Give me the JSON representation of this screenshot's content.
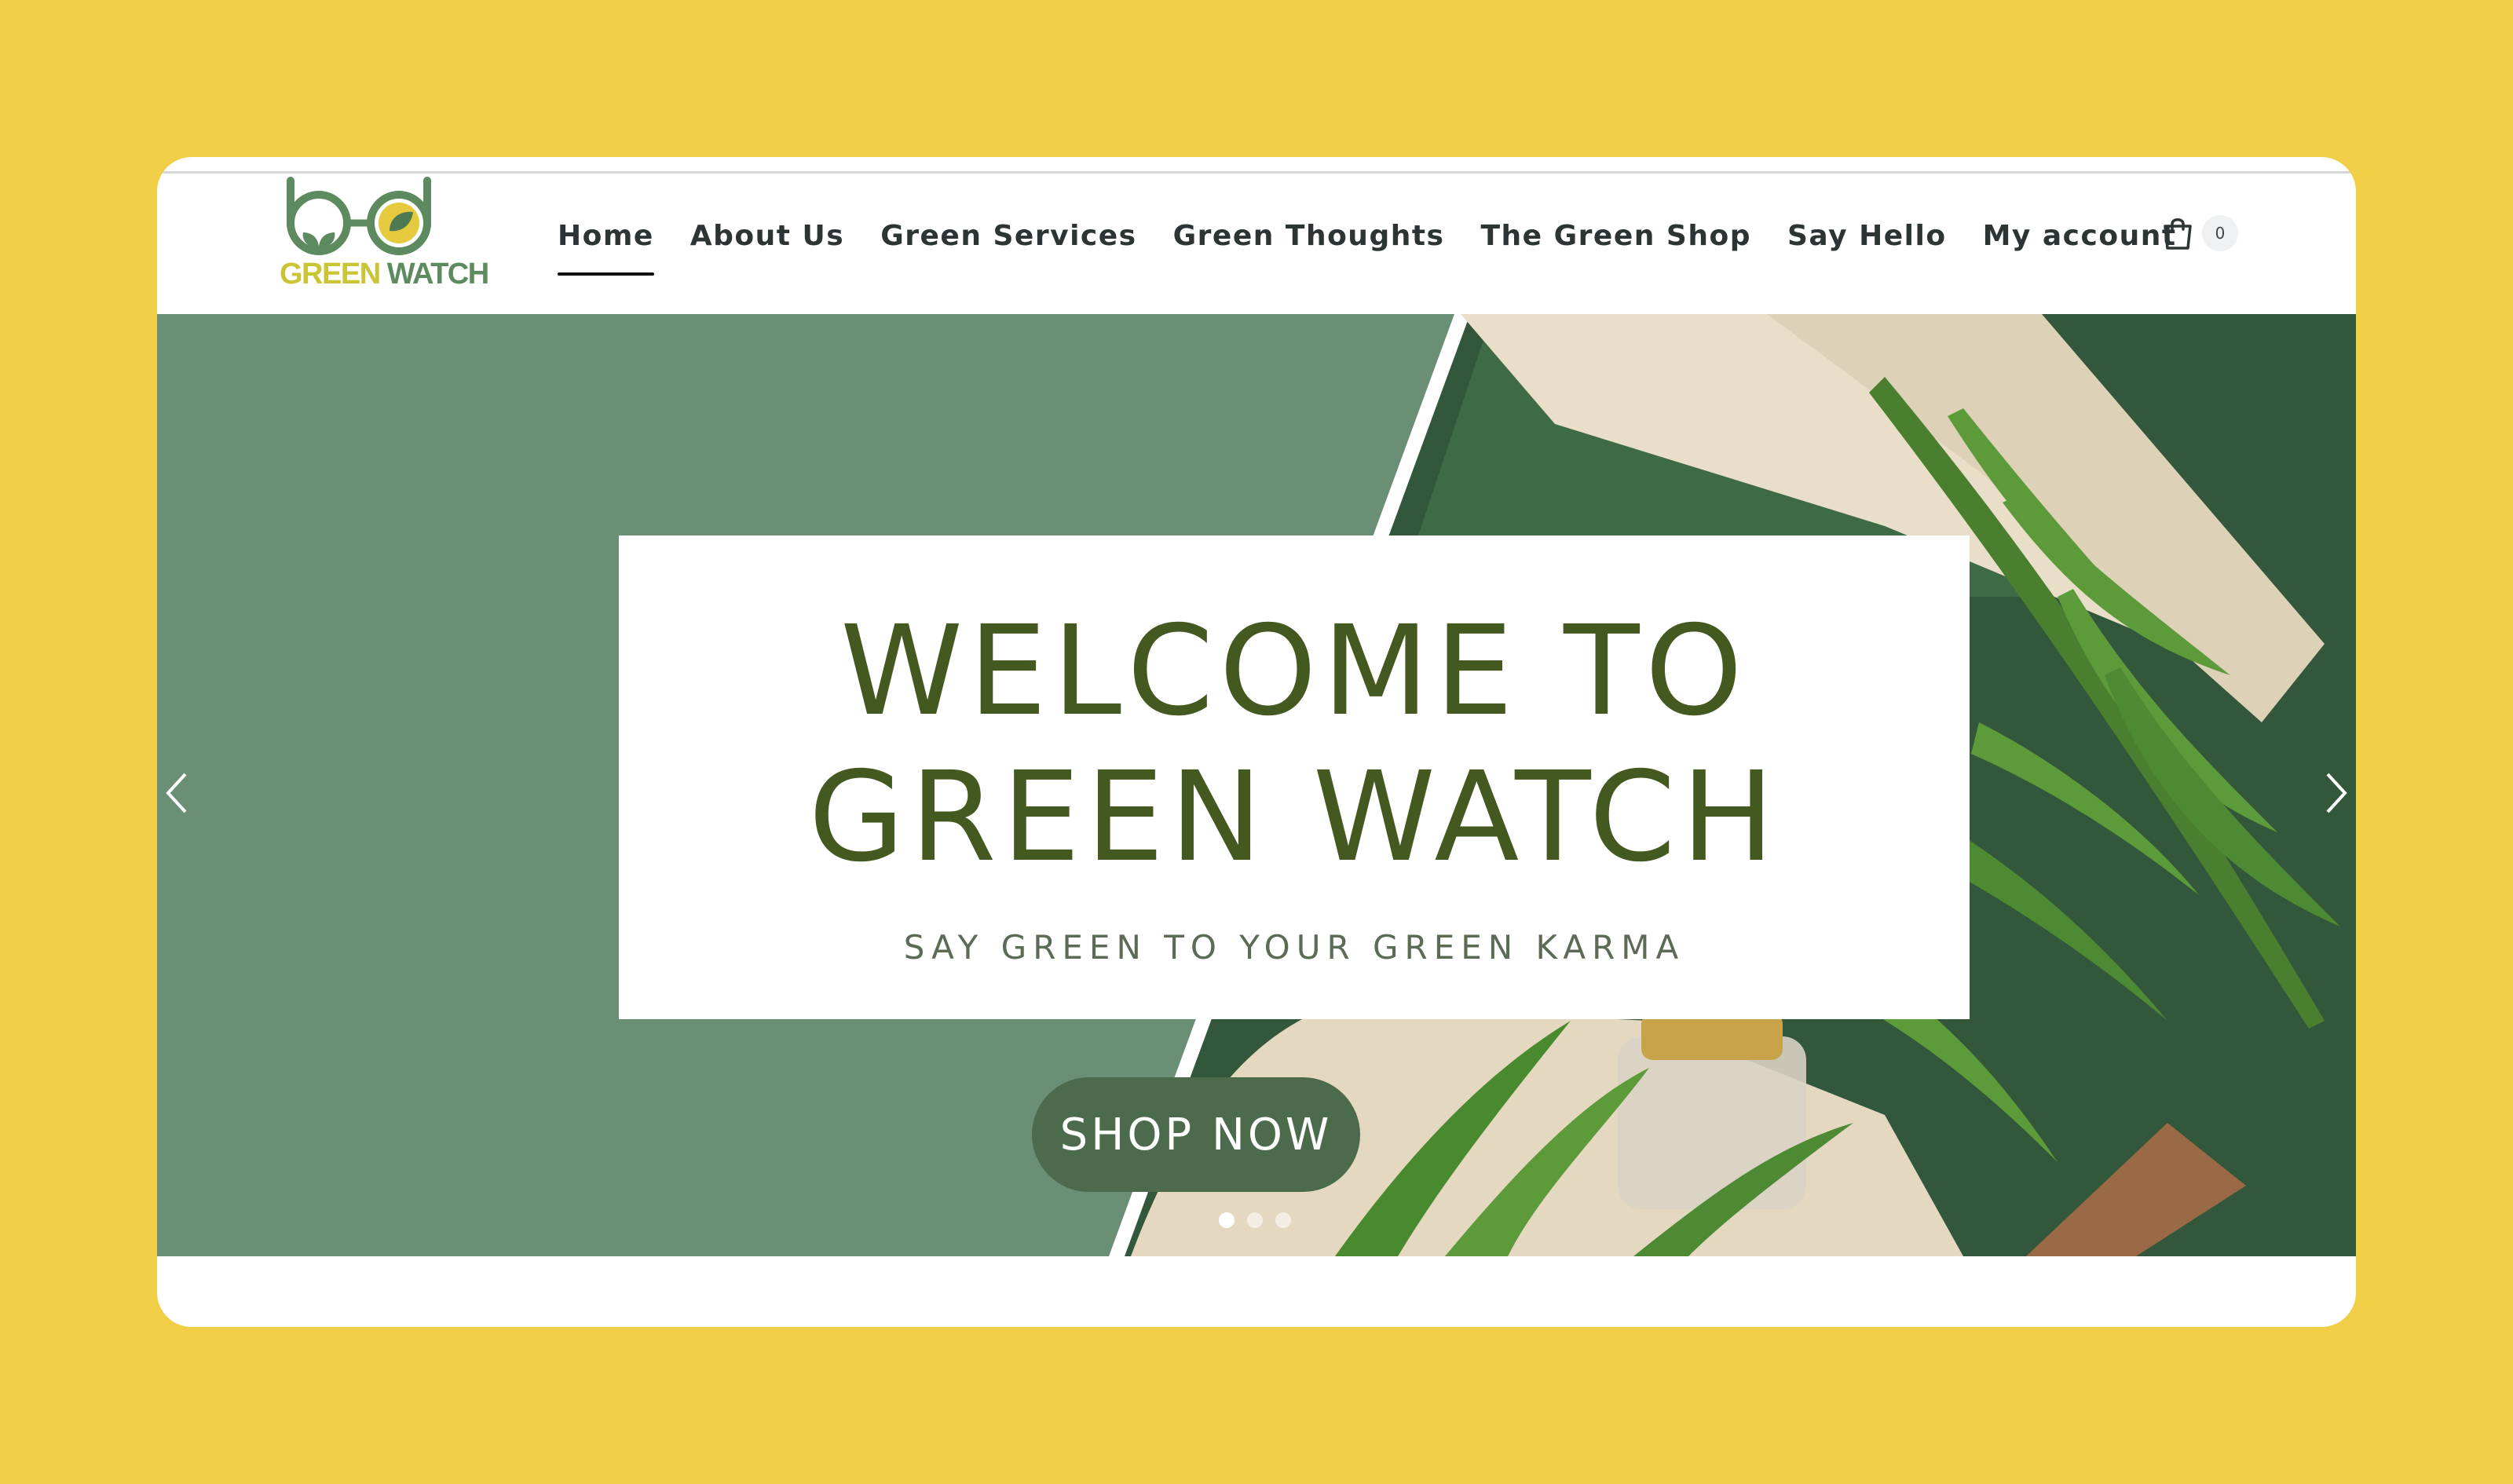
{
  "brand": {
    "logo_word_1": "GREEN",
    "logo_word_2": "WATCH"
  },
  "nav": {
    "items": [
      {
        "label": "Home",
        "active": true
      },
      {
        "label": "About Us"
      },
      {
        "label": "Green Services"
      },
      {
        "label": "Green Thoughts"
      },
      {
        "label": "The Green Shop"
      },
      {
        "label": "Say Hello"
      },
      {
        "label": "My account"
      }
    ]
  },
  "cart": {
    "icon": "shopping-bag-icon",
    "count": "0"
  },
  "hero": {
    "title_line_1": "WELCOME TO",
    "title_line_2": "GREEN WATCH",
    "tagline": "SAY GREEN TO YOUR GREEN KARMA",
    "cta_label": "SHOP NOW",
    "slides_total": 3,
    "active_slide": 1
  },
  "colors": {
    "page_background": "#f0cf47",
    "hero_green": "#6a8f74",
    "title_green": "#44591f",
    "cta_green": "#4b6b4c",
    "nav_text": "#2d3436"
  }
}
